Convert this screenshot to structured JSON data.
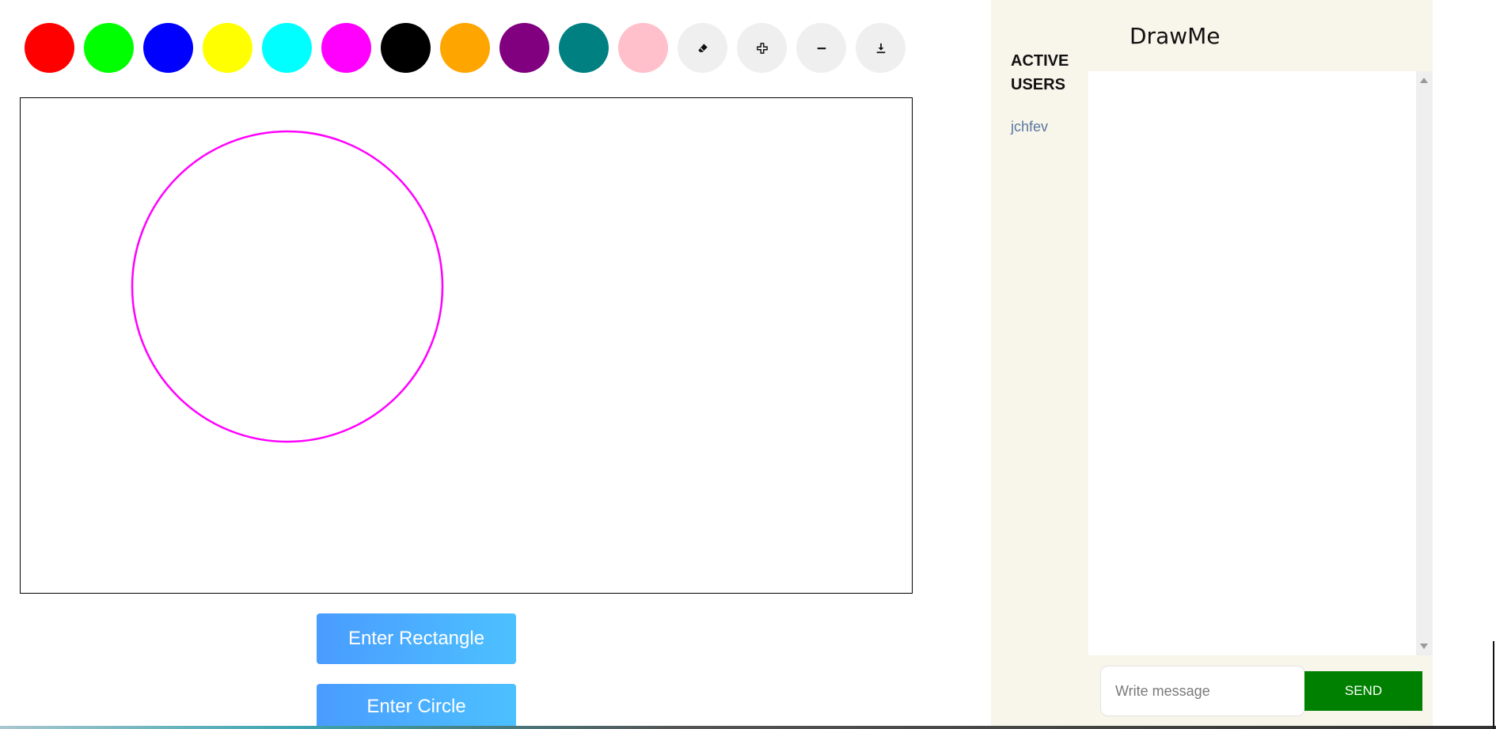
{
  "toolbar": {
    "colors": [
      {
        "name": "red",
        "hex": "#ff0000"
      },
      {
        "name": "green",
        "hex": "#00ff00"
      },
      {
        "name": "blue",
        "hex": "#0000ff"
      },
      {
        "name": "yellow",
        "hex": "#ffff00"
      },
      {
        "name": "cyan",
        "hex": "#00ffff"
      },
      {
        "name": "magenta",
        "hex": "#ff00ff"
      },
      {
        "name": "black",
        "hex": "#000000"
      },
      {
        "name": "orange",
        "hex": "#ffa500"
      },
      {
        "name": "purple",
        "hex": "#800080"
      },
      {
        "name": "teal",
        "hex": "#008080"
      },
      {
        "name": "pink",
        "hex": "#ffc0cb"
      }
    ],
    "tools": [
      "eraser-icon",
      "zoom-in-icon",
      "zoom-out-icon",
      "download-icon"
    ]
  },
  "canvas": {
    "shapes": [
      {
        "type": "circle",
        "stroke": "#ff00ff"
      }
    ]
  },
  "actions": {
    "rectangle_label": "Enter Rectangle",
    "circle_label": "Enter Circle"
  },
  "users": {
    "title": "ACTIVE USERS",
    "list": [
      "jchfev"
    ]
  },
  "chat": {
    "title": "DrawMe",
    "input_placeholder": "Write message",
    "send_label": "SEND",
    "send_color": "#008000"
  }
}
